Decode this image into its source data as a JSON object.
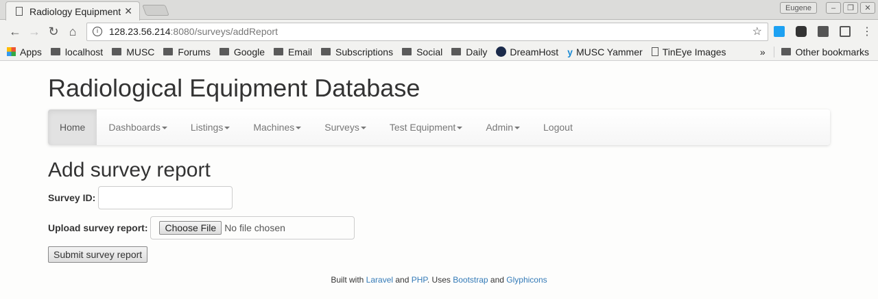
{
  "browser": {
    "tab_title": "Radiology Equipment",
    "user": "Eugene",
    "url_host": "128.23.56.214",
    "url_path": ":8080/surveys/addReport",
    "bookmarks": [
      "Apps",
      "localhost",
      "MUSC",
      "Forums",
      "Google",
      "Email",
      "Subscriptions",
      "Social",
      "Daily",
      "DreamHost",
      "MUSC Yammer",
      "TinEye Images"
    ],
    "overflow": "»",
    "other_bookmarks": "Other bookmarks"
  },
  "site": {
    "title": "Radiological Equipment Database"
  },
  "nav": [
    "Home",
    "Dashboards",
    "Listings",
    "Machines",
    "Surveys",
    "Test Equipment",
    "Admin",
    "Logout"
  ],
  "form": {
    "heading": "Add survey report",
    "survey_id_label": "Survey ID:",
    "survey_id_value": "",
    "upload_label": "Upload survey report:",
    "choose_file": "Choose File",
    "no_file": "No file chosen",
    "submit": "Submit survey report"
  },
  "footer": {
    "t1": "Built with ",
    "laravel": "Laravel",
    "t2": " and ",
    "php": "PHP",
    "t3": ". Uses ",
    "bootstrap": "Bootstrap",
    "t4": " and ",
    "glyphicons": "Glyphicons"
  }
}
